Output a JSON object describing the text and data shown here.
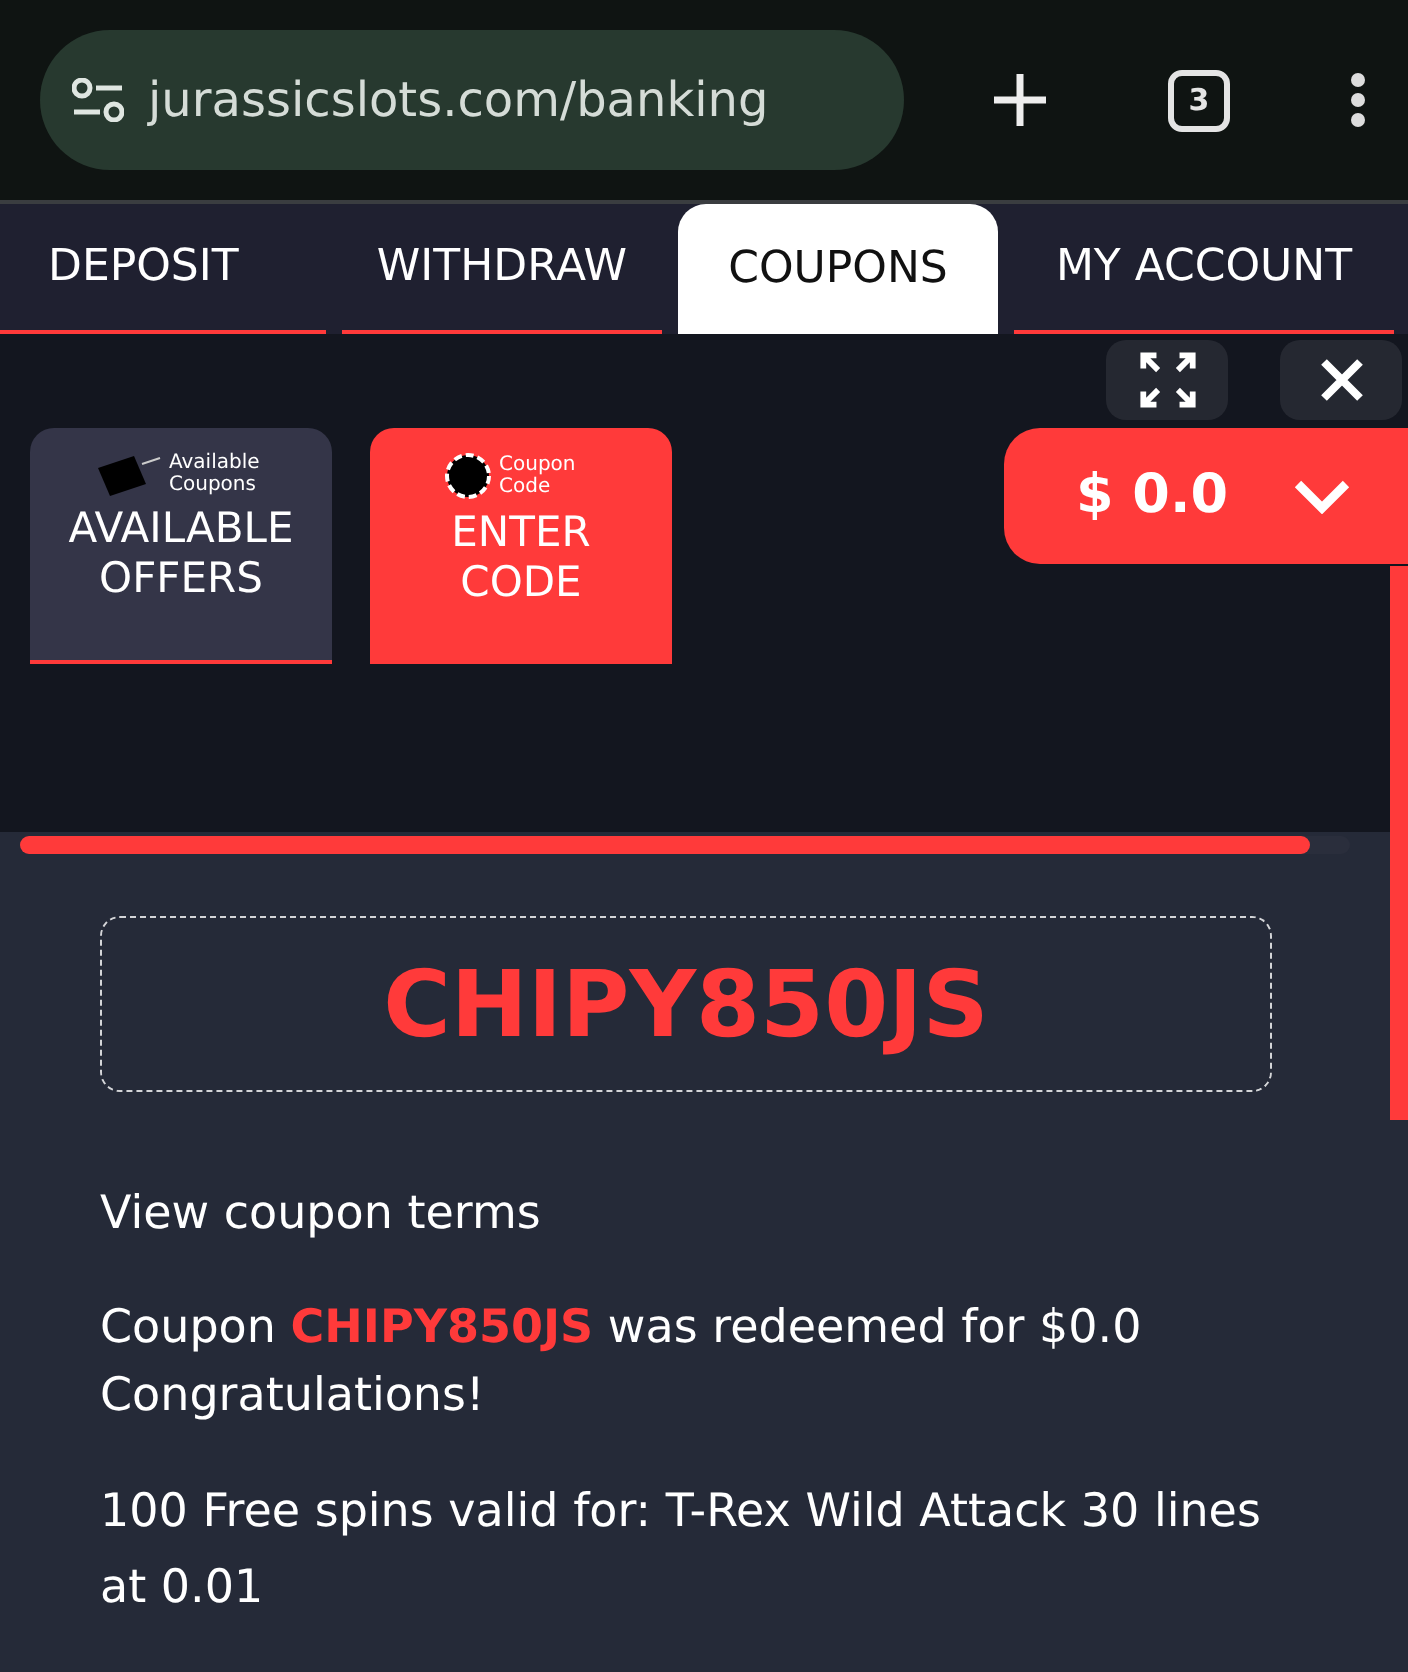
{
  "browser": {
    "url": "jurassicslots.com/banking",
    "tab_count": "3"
  },
  "tabs": [
    {
      "label": "DEPOSIT",
      "selected": false
    },
    {
      "label": "WITHDRAW",
      "selected": false
    },
    {
      "label": "COUPONS",
      "selected": true
    },
    {
      "label": "MY ACCOUNT",
      "selected": false
    }
  ],
  "balance": "$ 0.0",
  "coupon_tabs": [
    {
      "caption": "Available Coupons",
      "label": "AVAILABLE OFFERS",
      "kind": "tag",
      "selected": false
    },
    {
      "caption": "Coupon Code",
      "label": "ENTER CODE",
      "kind": "code",
      "selected": true
    }
  ],
  "progress": {
    "level": 0.97
  },
  "coupon_code": "CHIPY850JS",
  "terms_link": "View coupon terms",
  "messages": [
    "Coupon **CHIPY850JS** was redeemed for $0.0",
    "Congratulations!"
  ],
  "details": "100 Free spins valid for: T-Rex Wild Attack 30 lines at 0.01"
}
